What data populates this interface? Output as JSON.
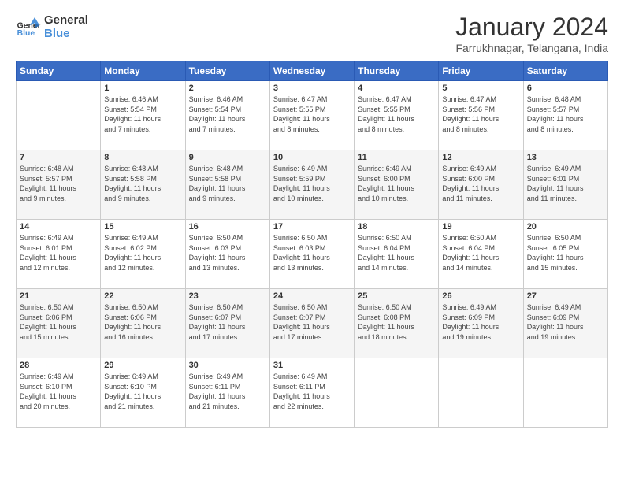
{
  "logo": {
    "line1": "General",
    "line2": "Blue"
  },
  "title": "January 2024",
  "subtitle": "Farrukhnagar, Telangana, India",
  "headers": [
    "Sunday",
    "Monday",
    "Tuesday",
    "Wednesday",
    "Thursday",
    "Friday",
    "Saturday"
  ],
  "weeks": [
    [
      {
        "num": "",
        "info": ""
      },
      {
        "num": "1",
        "info": "Sunrise: 6:46 AM\nSunset: 5:54 PM\nDaylight: 11 hours\nand 7 minutes."
      },
      {
        "num": "2",
        "info": "Sunrise: 6:46 AM\nSunset: 5:54 PM\nDaylight: 11 hours\nand 7 minutes."
      },
      {
        "num": "3",
        "info": "Sunrise: 6:47 AM\nSunset: 5:55 PM\nDaylight: 11 hours\nand 8 minutes."
      },
      {
        "num": "4",
        "info": "Sunrise: 6:47 AM\nSunset: 5:55 PM\nDaylight: 11 hours\nand 8 minutes."
      },
      {
        "num": "5",
        "info": "Sunrise: 6:47 AM\nSunset: 5:56 PM\nDaylight: 11 hours\nand 8 minutes."
      },
      {
        "num": "6",
        "info": "Sunrise: 6:48 AM\nSunset: 5:57 PM\nDaylight: 11 hours\nand 8 minutes."
      }
    ],
    [
      {
        "num": "7",
        "info": "Sunrise: 6:48 AM\nSunset: 5:57 PM\nDaylight: 11 hours\nand 9 minutes."
      },
      {
        "num": "8",
        "info": "Sunrise: 6:48 AM\nSunset: 5:58 PM\nDaylight: 11 hours\nand 9 minutes."
      },
      {
        "num": "9",
        "info": "Sunrise: 6:48 AM\nSunset: 5:58 PM\nDaylight: 11 hours\nand 9 minutes."
      },
      {
        "num": "10",
        "info": "Sunrise: 6:49 AM\nSunset: 5:59 PM\nDaylight: 11 hours\nand 10 minutes."
      },
      {
        "num": "11",
        "info": "Sunrise: 6:49 AM\nSunset: 6:00 PM\nDaylight: 11 hours\nand 10 minutes."
      },
      {
        "num": "12",
        "info": "Sunrise: 6:49 AM\nSunset: 6:00 PM\nDaylight: 11 hours\nand 11 minutes."
      },
      {
        "num": "13",
        "info": "Sunrise: 6:49 AM\nSunset: 6:01 PM\nDaylight: 11 hours\nand 11 minutes."
      }
    ],
    [
      {
        "num": "14",
        "info": "Sunrise: 6:49 AM\nSunset: 6:01 PM\nDaylight: 11 hours\nand 12 minutes."
      },
      {
        "num": "15",
        "info": "Sunrise: 6:49 AM\nSunset: 6:02 PM\nDaylight: 11 hours\nand 12 minutes."
      },
      {
        "num": "16",
        "info": "Sunrise: 6:50 AM\nSunset: 6:03 PM\nDaylight: 11 hours\nand 13 minutes."
      },
      {
        "num": "17",
        "info": "Sunrise: 6:50 AM\nSunset: 6:03 PM\nDaylight: 11 hours\nand 13 minutes."
      },
      {
        "num": "18",
        "info": "Sunrise: 6:50 AM\nSunset: 6:04 PM\nDaylight: 11 hours\nand 14 minutes."
      },
      {
        "num": "19",
        "info": "Sunrise: 6:50 AM\nSunset: 6:04 PM\nDaylight: 11 hours\nand 14 minutes."
      },
      {
        "num": "20",
        "info": "Sunrise: 6:50 AM\nSunset: 6:05 PM\nDaylight: 11 hours\nand 15 minutes."
      }
    ],
    [
      {
        "num": "21",
        "info": "Sunrise: 6:50 AM\nSunset: 6:06 PM\nDaylight: 11 hours\nand 15 minutes."
      },
      {
        "num": "22",
        "info": "Sunrise: 6:50 AM\nSunset: 6:06 PM\nDaylight: 11 hours\nand 16 minutes."
      },
      {
        "num": "23",
        "info": "Sunrise: 6:50 AM\nSunset: 6:07 PM\nDaylight: 11 hours\nand 17 minutes."
      },
      {
        "num": "24",
        "info": "Sunrise: 6:50 AM\nSunset: 6:07 PM\nDaylight: 11 hours\nand 17 minutes."
      },
      {
        "num": "25",
        "info": "Sunrise: 6:50 AM\nSunset: 6:08 PM\nDaylight: 11 hours\nand 18 minutes."
      },
      {
        "num": "26",
        "info": "Sunrise: 6:49 AM\nSunset: 6:09 PM\nDaylight: 11 hours\nand 19 minutes."
      },
      {
        "num": "27",
        "info": "Sunrise: 6:49 AM\nSunset: 6:09 PM\nDaylight: 11 hours\nand 19 minutes."
      }
    ],
    [
      {
        "num": "28",
        "info": "Sunrise: 6:49 AM\nSunset: 6:10 PM\nDaylight: 11 hours\nand 20 minutes."
      },
      {
        "num": "29",
        "info": "Sunrise: 6:49 AM\nSunset: 6:10 PM\nDaylight: 11 hours\nand 21 minutes."
      },
      {
        "num": "30",
        "info": "Sunrise: 6:49 AM\nSunset: 6:11 PM\nDaylight: 11 hours\nand 21 minutes."
      },
      {
        "num": "31",
        "info": "Sunrise: 6:49 AM\nSunset: 6:11 PM\nDaylight: 11 hours\nand 22 minutes."
      },
      {
        "num": "",
        "info": ""
      },
      {
        "num": "",
        "info": ""
      },
      {
        "num": "",
        "info": ""
      }
    ]
  ]
}
